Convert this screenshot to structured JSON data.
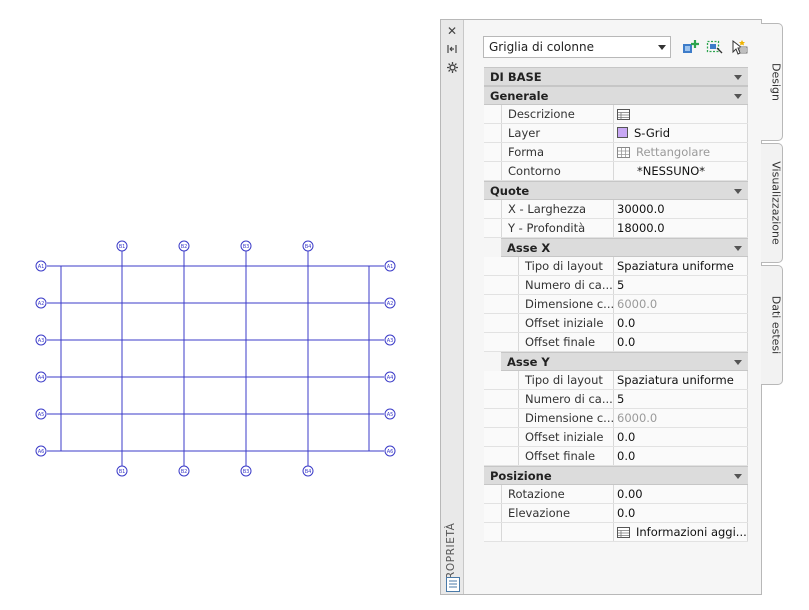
{
  "palette": {
    "vertical_title": "PROPRIETÀ",
    "selector_value": "Griglia di colonne",
    "tabs": [
      "Design",
      "Visualizzazione",
      "Dati estesi"
    ]
  },
  "properties": {
    "sections": [
      {
        "type": "section",
        "label": "DI BASE"
      },
      {
        "type": "section",
        "label": "Generale"
      },
      {
        "type": "prop",
        "level": 1,
        "label": "Descrizione",
        "value": "",
        "icon": "table-icon"
      },
      {
        "type": "prop",
        "level": 1,
        "label": "Layer",
        "value": "S-Grid",
        "icon": "layer-color-swatch"
      },
      {
        "type": "prop",
        "level": 1,
        "label": "Forma",
        "value": "Rettangolare",
        "icon": "grid-shape-icon",
        "gray": true
      },
      {
        "type": "prop",
        "level": 1,
        "label": "Contorno",
        "value": "*NESSUNO*",
        "indent": true
      },
      {
        "type": "section",
        "label": "Quote"
      },
      {
        "type": "prop",
        "level": 1,
        "label": "X - Larghezza",
        "value": "30000.0"
      },
      {
        "type": "prop",
        "level": 1,
        "label": "Y - Profondità",
        "value": "18000.0"
      },
      {
        "type": "subsection",
        "label": "Asse X"
      },
      {
        "type": "prop",
        "level": 2,
        "label": "Tipo di layout",
        "value": "Spaziatura uniforme"
      },
      {
        "type": "prop",
        "level": 2,
        "label": "Numero di ca...",
        "value": "5"
      },
      {
        "type": "prop",
        "level": 2,
        "label": "Dimensione c...",
        "value": "6000.0",
        "gray": true
      },
      {
        "type": "prop",
        "level": 2,
        "label": "Offset iniziale",
        "value": "0.0"
      },
      {
        "type": "prop",
        "level": 2,
        "label": "Offset finale",
        "value": "0.0"
      },
      {
        "type": "subsection",
        "label": "Asse Y"
      },
      {
        "type": "prop",
        "level": 2,
        "label": "Tipo di layout",
        "value": "Spaziatura uniforme"
      },
      {
        "type": "prop",
        "level": 2,
        "label": "Numero di ca...",
        "value": "5"
      },
      {
        "type": "prop",
        "level": 2,
        "label": "Dimensione c...",
        "value": "6000.0",
        "gray": true
      },
      {
        "type": "prop",
        "level": 2,
        "label": "Offset iniziale",
        "value": "0.0"
      },
      {
        "type": "prop",
        "level": 2,
        "label": "Offset finale",
        "value": "0.0"
      },
      {
        "type": "section",
        "label": "Posizione"
      },
      {
        "type": "prop",
        "level": 1,
        "label": "Rotazione",
        "value": "0.00"
      },
      {
        "type": "prop",
        "level": 1,
        "label": "Elevazione",
        "value": "0.0"
      },
      {
        "type": "prop",
        "level": 1,
        "label": "",
        "value": "Informazioni  aggi...",
        "icon": "table-icon"
      }
    ]
  },
  "drawing": {
    "line_color": "#3b3bc8",
    "top_bubbles": [
      "B1",
      "B2",
      "B3",
      "B4"
    ],
    "bottom_bubbles": [
      "B1",
      "B2",
      "B3",
      "B4"
    ],
    "left_bubbles": [
      "A1",
      "A2",
      "A3",
      "A4",
      "A5",
      "A6"
    ],
    "right_bubbles": [
      "A1",
      "A2",
      "A3",
      "A4",
      "A5",
      "A6"
    ]
  },
  "colors": {
    "layer_swatch": "#c8a8f4",
    "grid_lines": "#3b3bc8"
  }
}
